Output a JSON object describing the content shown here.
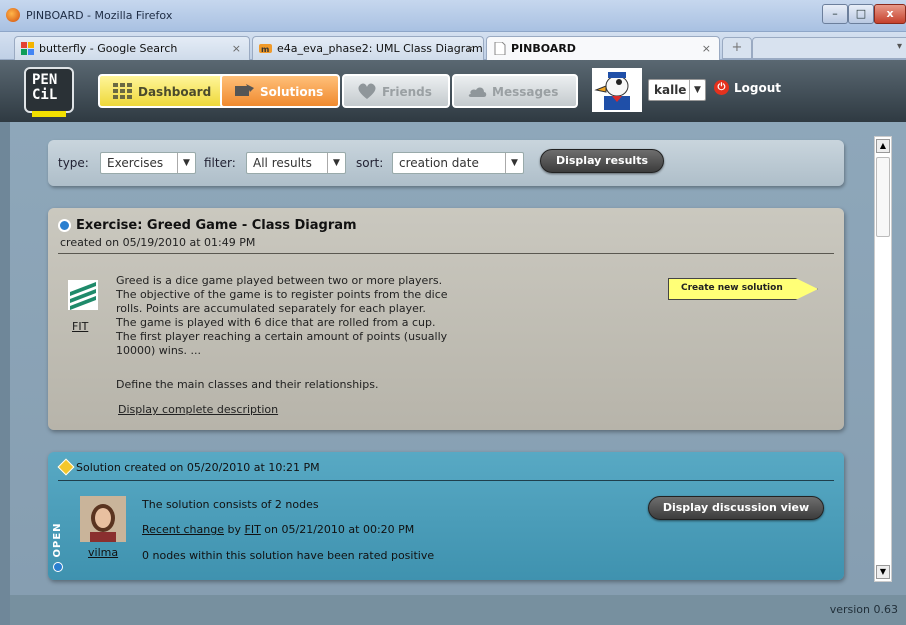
{
  "window": {
    "title": "PINBOARD - Mozilla Firefox",
    "controls": {
      "minimize": "–",
      "maximize": "□",
      "close": "x"
    }
  },
  "tabs": [
    {
      "label": "butterfly - Google Search",
      "close": "×"
    },
    {
      "label": "e4a_eva_phase2: UML Class Diagram",
      "close": "×"
    },
    {
      "label": "PINBOARD",
      "close": "×"
    }
  ],
  "tabbar": {
    "new_tab": "+",
    "list_tabs": "▾"
  },
  "app": {
    "logo_line1": "PEN",
    "logo_line2": "CiL",
    "nav": {
      "dashboard": "Dashboard",
      "solutions": "Solutions",
      "friends": "Friends",
      "messages": "Messages"
    },
    "user": "kalle",
    "logout": "Logout"
  },
  "filter": {
    "type_label": "type:",
    "type_value": "Exercises",
    "filter_label": "filter:",
    "filter_value": "All results",
    "sort_label": "sort:",
    "sort_value": "creation date",
    "display_button": "Display results"
  },
  "exercise": {
    "title": "Exercise: Greed Game - Class Diagram",
    "created": "created on 05/19/2010 at 01:49 PM",
    "author": "FIT",
    "description_lines": [
      "Greed is a dice game played between two or more players.",
      "The objective of the game is to register points from the dice",
      "rolls. Points are accumulated separately for each player.",
      "The game is played with 6 dice that are rolled from a cup.",
      "The first player reaching a certain amount of points (usually",
      "10000) wins. ..."
    ],
    "task": "Define the main classes and their relationships.",
    "more_link": "Display complete description",
    "create_button": "Create new solution"
  },
  "solution": {
    "header": "Solution created on 05/20/2010 at 10:21 PM",
    "status": "OPEN",
    "author": "vilma",
    "nodes": "The solution consists of 2 nodes",
    "recent_link": "Recent change",
    "recent_by": "by",
    "recent_author": "FIT",
    "recent_time": "on 05/21/2010 at 00:20 PM",
    "rated": "0 nodes within this solution have been rated positive",
    "discussion_button": "Display discussion view"
  },
  "footer": {
    "version": "version 0.63"
  },
  "colors": {
    "header_bg": "#2f3a42",
    "content_bg": "#8ea7ba",
    "solution_card": "#4a9fbc",
    "exercise_card": "#c2c0b7"
  }
}
